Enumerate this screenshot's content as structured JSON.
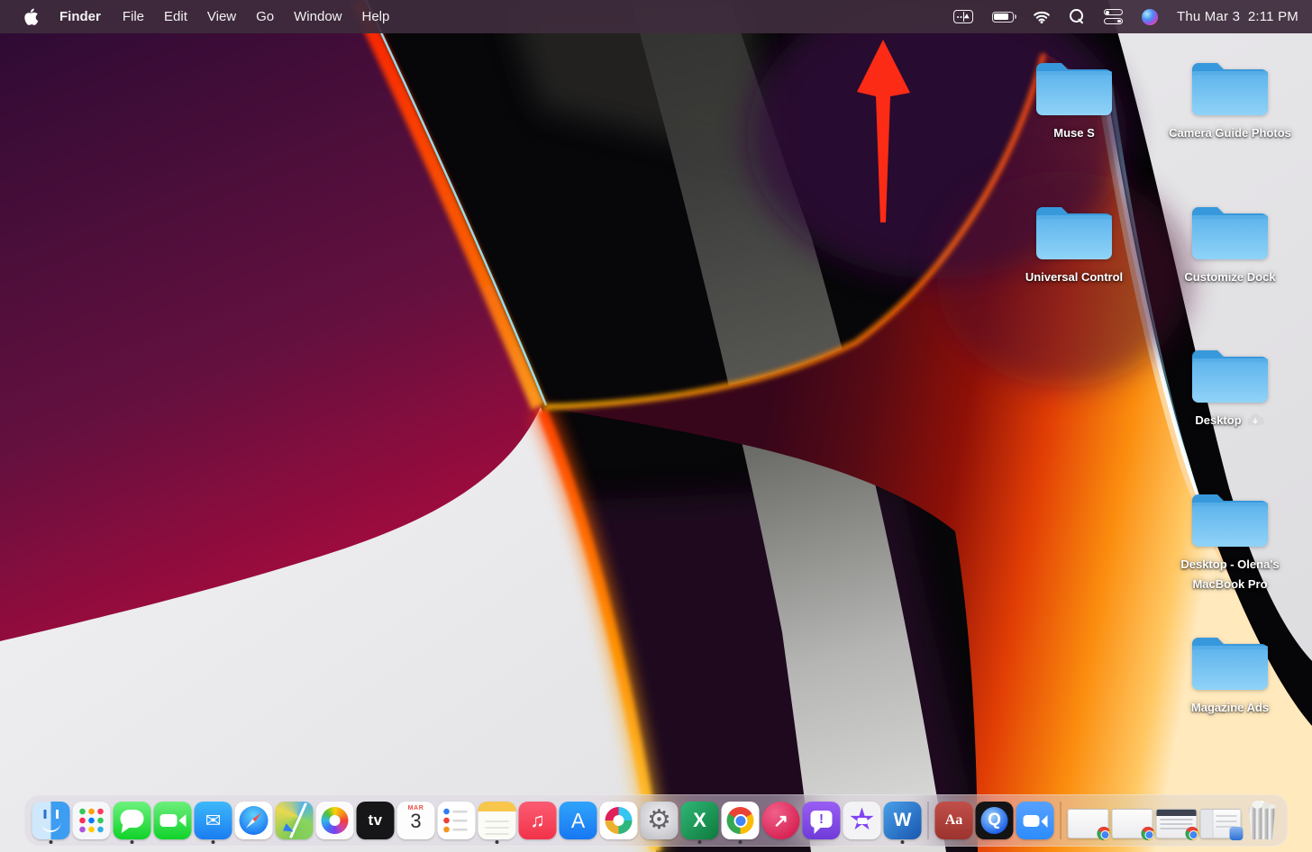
{
  "menu_bar": {
    "menus": [
      {
        "label": "Finder",
        "bold": true
      },
      {
        "label": "File"
      },
      {
        "label": "Edit"
      },
      {
        "label": "View"
      },
      {
        "label": "Go"
      },
      {
        "label": "Window"
      },
      {
        "label": "Help"
      }
    ],
    "status_icons": [
      "display-mirroring-icon",
      "battery-icon",
      "wifi-icon",
      "spotlight-search-icon",
      "control-center-icon",
      "siri-icon"
    ],
    "clock": "Thu Mar 3  2:11 PM"
  },
  "annotation": {
    "type": "red-up-arrow",
    "points_to": "display-mirroring-icon"
  },
  "desktop": {
    "folders": [
      {
        "label": "Muse S"
      },
      {
        "label": "Camera Guide Photos"
      },
      {
        "label": "Universal Control"
      },
      {
        "label": "Customize Dock"
      },
      {
        "label": "Desktop",
        "icloud_download_badge": true
      },
      {
        "label": "Desktop - Olena's MacBook Pro"
      },
      {
        "label": "Magazine Ads"
      }
    ]
  },
  "dock": {
    "items": [
      {
        "name": "finder",
        "running": true
      },
      {
        "name": "launchpad"
      },
      {
        "name": "messages",
        "running": true
      },
      {
        "name": "facetime"
      },
      {
        "name": "mail",
        "glyph": "✉",
        "running": true
      },
      {
        "name": "safari"
      },
      {
        "name": "maps"
      },
      {
        "name": "photos"
      },
      {
        "name": "appletv",
        "glyph": "tv"
      },
      {
        "name": "calendar",
        "glyph_top": "MAR",
        "glyph": "3"
      },
      {
        "name": "reminders"
      },
      {
        "name": "notes",
        "running": true
      },
      {
        "name": "music",
        "glyph": "♫"
      },
      {
        "name": "appstore",
        "glyph": "A"
      },
      {
        "name": "slack"
      },
      {
        "name": "systempreferences",
        "glyph": "⚙"
      },
      {
        "name": "excel",
        "glyph": "X",
        "running": true
      },
      {
        "name": "chrome",
        "running": true
      },
      {
        "name": "skitch",
        "glyph": "↗"
      },
      {
        "name": "feedback",
        "glyph": "!"
      },
      {
        "name": "imovie",
        "glyph": "★"
      },
      {
        "name": "word",
        "glyph": "W",
        "running": true
      },
      {
        "name": "separator-1",
        "type": "separator"
      },
      {
        "name": "dictionary",
        "glyph": "Aa"
      },
      {
        "name": "quicktime",
        "glyph": "Q"
      },
      {
        "name": "zoom"
      },
      {
        "name": "separator-2",
        "type": "separator"
      },
      {
        "name": "minimized-window-chrome-1",
        "type": "window",
        "badge": "chrome"
      },
      {
        "name": "minimized-window-chrome-2",
        "type": "window",
        "badge": "chrome"
      },
      {
        "name": "minimized-window-chrome-3",
        "type": "window",
        "badge": "chrome",
        "variant": "page"
      },
      {
        "name": "minimized-window-document",
        "type": "window",
        "badge": "doc",
        "variant": "doc"
      },
      {
        "name": "trash",
        "type": "trash"
      }
    ]
  },
  "palette": {
    "arrow_red": "#fb2b15",
    "folder_blue": "#6cc0f2",
    "menu_bar_bg": "#3e2c3c",
    "desktop_gray": "#e4e3e6"
  }
}
